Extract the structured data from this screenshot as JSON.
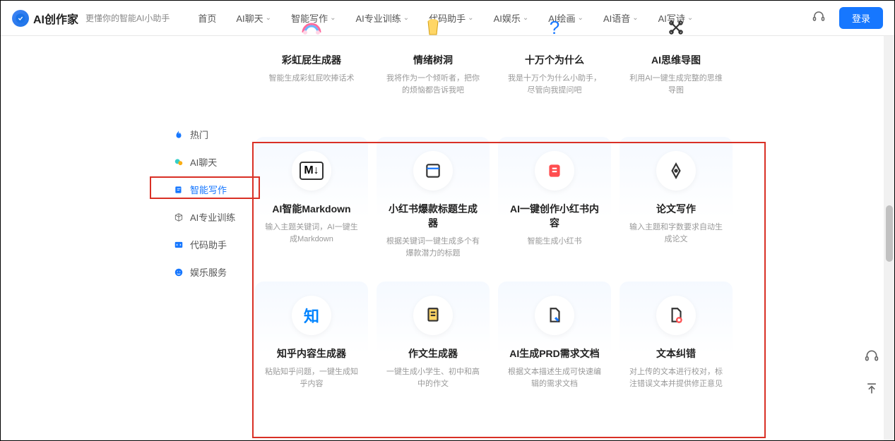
{
  "header": {
    "logo_text": "AI创作家",
    "tagline": "更懂你的智能AI小助手",
    "login": "登录",
    "nav": [
      {
        "label": "首页",
        "dropdown": false
      },
      {
        "label": "AI聊天",
        "dropdown": true
      },
      {
        "label": "智能写作",
        "dropdown": true
      },
      {
        "label": "AI专业训练",
        "dropdown": true
      },
      {
        "label": "代码助手",
        "dropdown": true
      },
      {
        "label": "AI娱乐",
        "dropdown": true
      },
      {
        "label": "AI绘画",
        "dropdown": true
      },
      {
        "label": "AI语音",
        "dropdown": true
      },
      {
        "label": "AI写诗",
        "dropdown": true
      }
    ]
  },
  "sidebar": {
    "items": [
      {
        "label": "热门",
        "icon": "fire-icon",
        "color": "#1677ff"
      },
      {
        "label": "AI聊天",
        "icon": "chat-icon",
        "color": "#faad14"
      },
      {
        "label": "智能写作",
        "icon": "edit-icon",
        "color": "#1677ff",
        "active": true
      },
      {
        "label": "AI专业训练",
        "icon": "cube-icon",
        "color": "#666"
      },
      {
        "label": "代码助手",
        "icon": "code-icon",
        "color": "#1677ff"
      },
      {
        "label": "娱乐服务",
        "icon": "smile-icon",
        "color": "#1677ff"
      }
    ]
  },
  "cards_row1": [
    {
      "title": "彩虹屁生成器",
      "desc": "智能生成彩虹屁吹捧话术",
      "icon": "🌈"
    },
    {
      "title": "情绪树洞",
      "desc": "我将作为一个倾听者，把你的烦恼都告诉我吧",
      "icon": "🗑️"
    },
    {
      "title": "十万个为什么",
      "desc": "我是十万个为什么小助手，尽管向我提问吧",
      "icon": "❓"
    },
    {
      "title": "AI思维导图",
      "desc": "利用AI一键生成完整的思维导图",
      "icon": "✖️"
    }
  ],
  "cards_row2": [
    {
      "title": "AI智能Markdown",
      "desc": "输入主题关键词，AI一键生成Markdown",
      "icon": "M↓"
    },
    {
      "title": "小红书爆款标题生成器",
      "desc": "根据关键词一键生成多个有爆款潜力的标题",
      "icon": "🗔"
    },
    {
      "title": "AI一键创作小红书内容",
      "desc": "智能生成小红书",
      "icon": "📕"
    },
    {
      "title": "论文写作",
      "desc": "输入主题和字数要求自动生成论文",
      "icon": "✒️"
    }
  ],
  "cards_row3": [
    {
      "title": "知乎内容生成器",
      "desc": "粘贴知乎问题，一键生成知乎内容",
      "icon": "知"
    },
    {
      "title": "作文生成器",
      "desc": "一键生成小学生、初中和高中的作文",
      "icon": "📄"
    },
    {
      "title": "AI生成PRD需求文档",
      "desc": "根据文本描述生成可快速编辑的需求文档",
      "icon": "📝"
    },
    {
      "title": "文本纠错",
      "desc": "对上传的文本进行校对，标注错误文本并提供修正意见",
      "icon": "📋"
    }
  ]
}
